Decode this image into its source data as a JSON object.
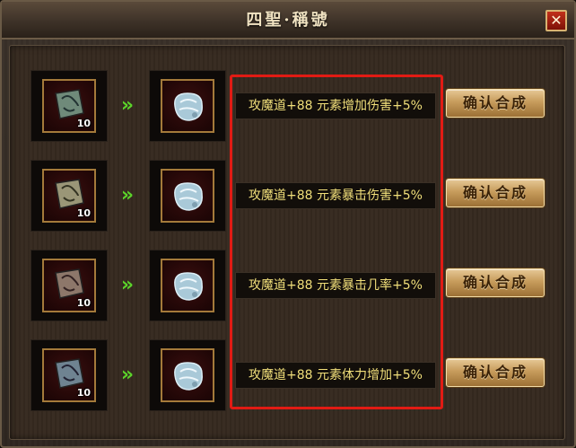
{
  "window": {
    "title": "四聖·稱號",
    "close_label": "✕"
  },
  "rows": [
    {
      "material_count": "10",
      "effect": "攻魔道+88 元素增加伤害+5%",
      "button_label": "确认合成",
      "material_tint": "#6f8a7a"
    },
    {
      "material_count": "10",
      "effect": "攻魔道+88 元素暴击伤害+5%",
      "button_label": "确认合成",
      "material_tint": "#9a9677"
    },
    {
      "material_count": "10",
      "effect": "攻魔道+88 元素暴击几率+5%",
      "button_label": "确认合成",
      "material_tint": "#8d776a"
    },
    {
      "material_count": "10",
      "effect": "攻魔道+88 元素体力增加+5%",
      "button_label": "确认合成",
      "material_tint": "#6f8391"
    }
  ],
  "arrow_glyph": "»",
  "colors": {
    "highlight": "#e11b14",
    "effect_text": "#f1df7a",
    "arrow": "#5bd42a",
    "slot_frame": "#a47a3a"
  }
}
